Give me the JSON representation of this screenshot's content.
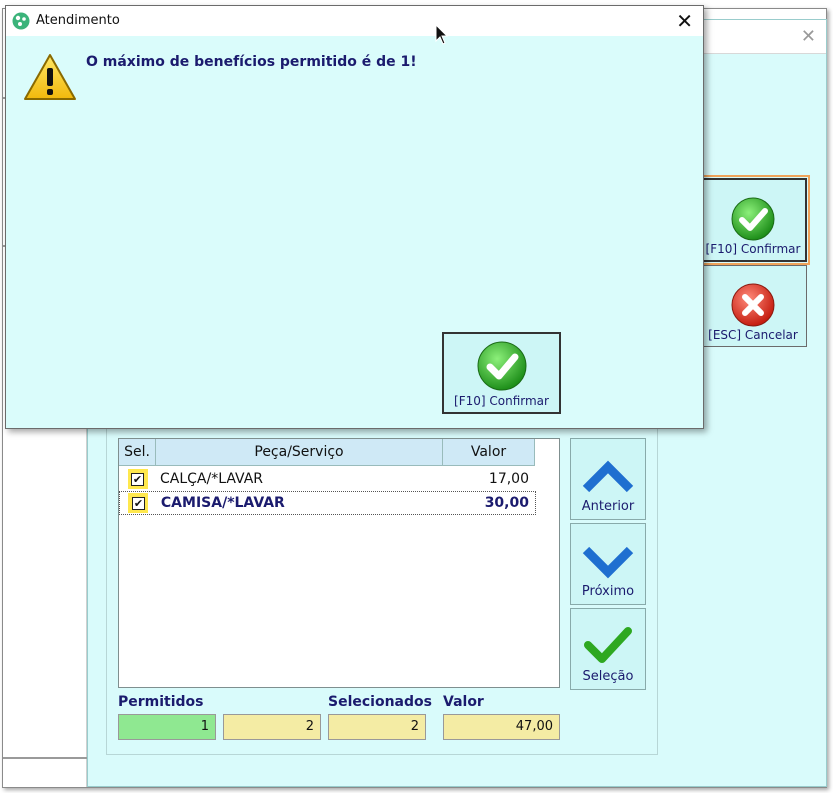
{
  "dialog": {
    "title": "Atendimento",
    "message": "O máximo de benefícios permitido é de 1!",
    "confirm_label": "[F10] Confirmar"
  },
  "side_buttons": {
    "confirm_label": "[F10] Confirmar",
    "cancel_label": "[ESC] Cancelar"
  },
  "grid": {
    "columns": [
      "Sel.",
      "Peça/Serviço",
      "Valor"
    ],
    "rows": [
      {
        "item": "CALÇA/*LAVAR",
        "valor": "17,00",
        "checked": true
      },
      {
        "item": "CAMISA/*LAVAR",
        "valor": "30,00",
        "checked": true
      }
    ]
  },
  "nav": {
    "previous_label": "Anterior",
    "next_label": "Próximo",
    "select_label": "Seleção"
  },
  "summary": {
    "permitidos_label": "Permitidos",
    "selecionados_label": "Selecionados",
    "valor_label": "Valor",
    "permitidos_value": "1",
    "unlabeled_value": "2",
    "selecionados_value": "2",
    "valor_value": "47,00"
  },
  "colors": {
    "dialog_bg": "#dafcfb",
    "label_text": "#1b1b6e",
    "permitidos_bg": "#8fe891",
    "counter_bg": "#f4eca4",
    "checkbox_bg": "#ffe84d",
    "focus_outline": "#f0a35a"
  }
}
